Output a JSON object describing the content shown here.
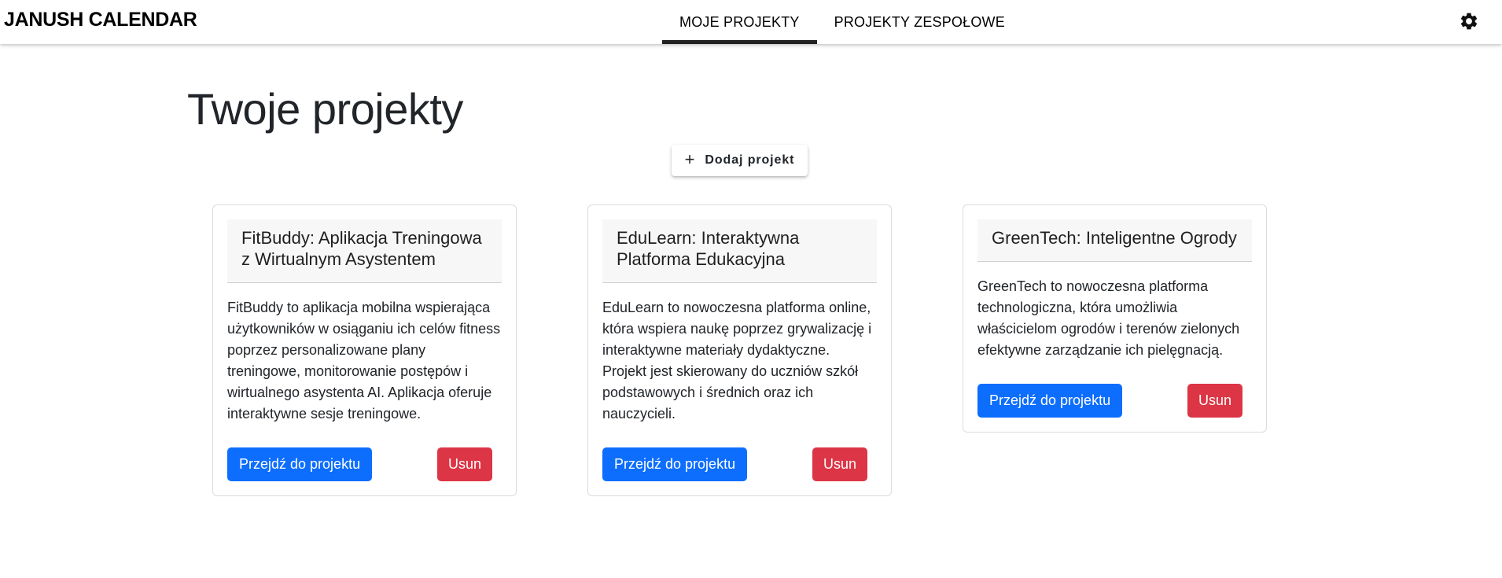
{
  "app": {
    "brand": "JANUSH CALENDAR"
  },
  "nav": {
    "tabs": [
      {
        "label": "MOJE PROJEKTY",
        "active": true
      },
      {
        "label": "PROJEKTY ZESPOŁOWE",
        "active": false
      }
    ],
    "settings_icon": "gear-icon"
  },
  "main": {
    "title": "Twoje projekty",
    "add_button": {
      "icon": "plus-icon",
      "label": "Dodaj projekt"
    }
  },
  "projects": [
    {
      "title": "FitBuddy: Aplikacja Treningowa z Wirtualnym Asystentem",
      "description": "FitBuddy to aplikacja mobilna wspierająca użytkowników w osiąganiu ich celów fitness poprzez personalizowane plany treningowe, monitorowanie postępów i wirtualnego asystenta AI. Aplikacja oferuje interaktywne sesje treningowe.",
      "open_label": "Przejdź do projektu",
      "delete_label": "Usun"
    },
    {
      "title": "EduLearn: Interaktywna Platforma Edukacyjna",
      "description": "EduLearn to nowoczesna platforma online, która wspiera naukę poprzez grywalizację i interaktywne materiały dydaktyczne. Projekt jest skierowany do uczniów szkół podstawowych i średnich oraz ich nauczycieli.",
      "open_label": "Przejdź do projektu",
      "delete_label": "Usun"
    },
    {
      "title": "GreenTech: Inteligentne Ogrody",
      "description": "GreenTech to nowoczesna platforma technologiczna, która umożliwia właścicielom ogrodów i terenów zielonych efektywne zarządzanie ich pielęgnacją.",
      "open_label": "Przejdź do projektu",
      "delete_label": "Usun"
    }
  ],
  "colors": {
    "primary": "#0d6efd",
    "danger": "#dc3545",
    "card_header_bg": "#f7f7f7",
    "active_tab_indicator": "#212121"
  }
}
